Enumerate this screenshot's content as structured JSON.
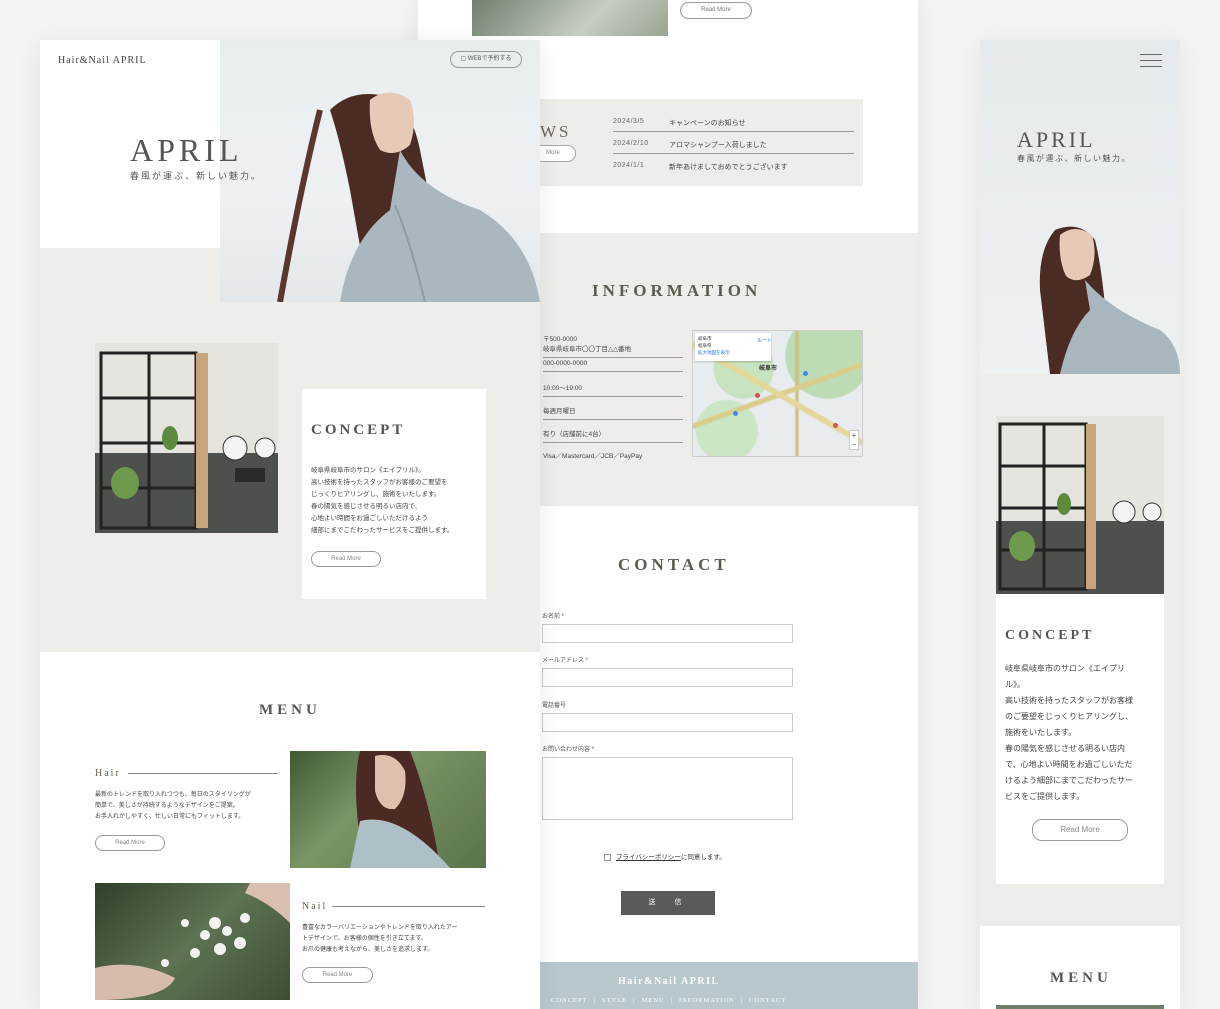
{
  "center": {
    "top_read_more": "Read More",
    "news": {
      "title_partial": "WS",
      "more_partial": "More",
      "items": [
        {
          "date": "2024/3/5",
          "text": "キャンペーンのお知らせ"
        },
        {
          "date": "2024/2/10",
          "text": "アロマシャンプー入荷しました"
        },
        {
          "date": "2024/1/1",
          "text": "新年あけましておめでとうございます"
        }
      ]
    },
    "information": {
      "title": "INFORMATION",
      "postal": "〒500-0000",
      "address": "岐阜県岐阜市〇〇丁目△△番地",
      "phone": "000-0000-0000",
      "hours": "10:00〜19:00",
      "closed": "毎週月曜日",
      "parking": "有り（店舗前に4台）",
      "payment": "Visa／Mastercard／JCB／PayPay",
      "map": {
        "place": "岐阜市",
        "place_sub": "岐阜県",
        "route": "ルート",
        "enlarge": "拡大地図を表示",
        "city_label": "岐阜市",
        "zoom_in": "+",
        "zoom_out": "−"
      }
    },
    "contact": {
      "title": "CONTACT",
      "fields": [
        {
          "label": "お名前 *"
        },
        {
          "label": "メールアドレス *"
        },
        {
          "label": "電話番号"
        },
        {
          "label": "お問い合わせ内容 *"
        }
      ],
      "privacy_link": "プライバシーポリシー",
      "privacy_suffix": "に同意します。",
      "submit": "送　信"
    },
    "footer": {
      "brand": "Hair&Nail APRIL",
      "nav": [
        "CONCEPT",
        "STYLE",
        "MENU",
        "INFORMATION",
        "CONTACT"
      ],
      "separator": "|"
    }
  },
  "left": {
    "brand": "Hair&Nail APRIL",
    "web_button": "WEBで予約する",
    "hero_title": "APRIL",
    "hero_subtitle": "春風が運ぶ、新しい魅力。",
    "concept": {
      "title": "CONCEPT",
      "lines": [
        "岐阜県岐阜市のサロン《エイプリル》。",
        "高い技術を持ったスタッフがお客様のご要望を",
        "じっくりヒアリングし、施術をいたします。",
        "春の陽気を感じさせる明るい店内で、",
        "心地よい時間をお過ごしいただけるよう",
        "細部にまでこだわったサービスをご提供します。"
      ],
      "read_more": "Read More"
    },
    "menu": {
      "title": "MENU",
      "hair": {
        "label": "Hair",
        "lines": [
          "最新のトレンドを取り入れつつも、毎日のスタイリングが",
          "簡単で、美しさが持続するようなデザインをご提案。",
          "お手入れがしやすく、忙しい日常にもフィットします。"
        ],
        "read_more": "Read More"
      },
      "nail": {
        "label": "Nail",
        "lines": [
          "豊富なカラーバリエーションやトレンドを取り入れたアー",
          "トデザインで、お客様の個性を引き立てます。",
          "お爪の健康も考えながら、美しさを追求します。"
        ],
        "read_more": "Read More"
      }
    }
  },
  "right": {
    "hero_title": "APRIL",
    "hero_subtitle": "春風が運ぶ、新しい魅力。",
    "concept": {
      "title": "CONCEPT",
      "lines": [
        "岐阜県岐阜市のサロン《エイプリ",
        "ル》。",
        "高い技術を持ったスタッフがお客様",
        "のご要望をじっくりヒアリングし、",
        "施術をいたします。",
        "春の陽気を感じさせる明るい店内",
        "で、心地よい時間をお過ごしいただ",
        "けるよう細部にまでこだわったサー",
        "ビスをご提供します。"
      ],
      "read_more": "Read More"
    },
    "menu_title": "MENU"
  }
}
